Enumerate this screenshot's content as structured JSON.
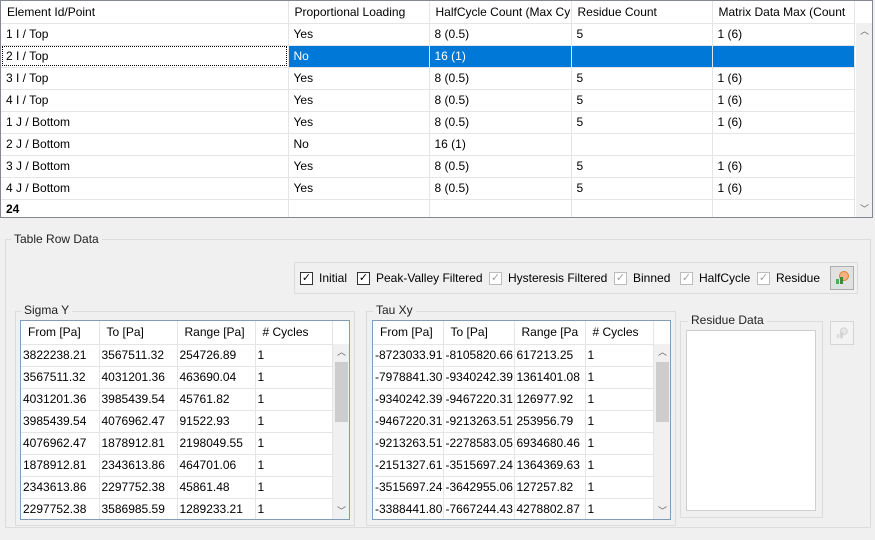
{
  "main_table": {
    "columns": [
      "Element Id/Point",
      "Proportional Loading",
      "HalfCycle Count (Max Cy",
      "Residue Count",
      "Matrix Data Max (Count"
    ],
    "rows": [
      [
        "1 I / Top",
        "Yes",
        "8 (0.5)",
        "5",
        "1 (6)"
      ],
      [
        "2 I / Top",
        "No",
        "16 (1)",
        "",
        ""
      ],
      [
        "3 I / Top",
        "Yes",
        "8 (0.5)",
        "5",
        "1 (6)"
      ],
      [
        "4 I / Top",
        "Yes",
        "8 (0.5)",
        "5",
        "1 (6)"
      ],
      [
        "1 J / Bottom",
        "Yes",
        "8 (0.5)",
        "5",
        "1 (6)"
      ],
      [
        "2 J / Bottom",
        "No",
        "16 (1)",
        "",
        ""
      ],
      [
        "3 J / Bottom",
        "Yes",
        "8 (0.5)",
        "5",
        "1 (6)"
      ],
      [
        "4 J / Bottom",
        "Yes",
        "8 (0.5)",
        "5",
        "1 (6)"
      ]
    ],
    "selected_row": 1,
    "count_row": "24"
  },
  "table_row_data": {
    "label": "Table Row Data",
    "checkboxes": [
      {
        "label": "Initial",
        "checked": true,
        "enabled": true
      },
      {
        "label": "Peak-Valley Filtered",
        "checked": true,
        "enabled": true
      },
      {
        "label": "Hysteresis Filtered",
        "checked": true,
        "enabled": false
      },
      {
        "label": "Binned",
        "checked": true,
        "enabled": false
      },
      {
        "label": "HalfCycle",
        "checked": true,
        "enabled": false
      },
      {
        "label": "Residue",
        "checked": true,
        "enabled": false
      }
    ],
    "refresh_icon": "chart-refresh-icon"
  },
  "sigma_y": {
    "label": "Sigma Y",
    "columns": [
      "From  [Pa]",
      "To  [Pa]",
      "Range  [Pa]",
      "# Cycles"
    ],
    "rows": [
      [
        "3822238.21",
        "3567511.32",
        "254726.89",
        "1"
      ],
      [
        "3567511.32",
        "4031201.36",
        "463690.04",
        "1"
      ],
      [
        "4031201.36",
        "3985439.54",
        "45761.82",
        "1"
      ],
      [
        "3985439.54",
        "4076962.47",
        "91522.93",
        "1"
      ],
      [
        "4076962.47",
        "1878912.81",
        "2198049.55",
        "1"
      ],
      [
        "1878912.81",
        "2343613.86",
        "464701.06",
        "1"
      ],
      [
        "2343613.86",
        "2297752.38",
        "45861.48",
        "1"
      ],
      [
        "2297752.38",
        "3586985.59",
        "1289233.21",
        "1"
      ]
    ]
  },
  "tau_xy": {
    "label": "Tau Xy",
    "columns": [
      "From  [Pa]",
      "To  [Pa]",
      "Range  [Pa",
      "# Cycles"
    ],
    "rows": [
      [
        "-8723033.91",
        "-8105820.66",
        "617213.25",
        "1"
      ],
      [
        "-7978841.30",
        "-9340242.39",
        "1361401.08",
        "1"
      ],
      [
        "-9340242.39",
        "-9467220.31",
        "126977.92",
        "1"
      ],
      [
        "-9467220.31",
        "-9213263.51",
        "253956.79",
        "1"
      ],
      [
        "-9213263.51",
        "-2278583.05",
        "6934680.46",
        "1"
      ],
      [
        "-2151327.61",
        "-3515697.24",
        "1364369.63",
        "1"
      ],
      [
        "-3515697.24",
        "-3642955.06",
        "127257.82",
        "1"
      ],
      [
        "-3388441.80",
        "-7667244.43",
        "4278802.87",
        "1"
      ]
    ]
  },
  "residue": {
    "label": "Residue Data",
    "icon": "chart-icon"
  },
  "colors": {
    "selection": "#0078d7",
    "window_bg": "#f0f0f0"
  }
}
